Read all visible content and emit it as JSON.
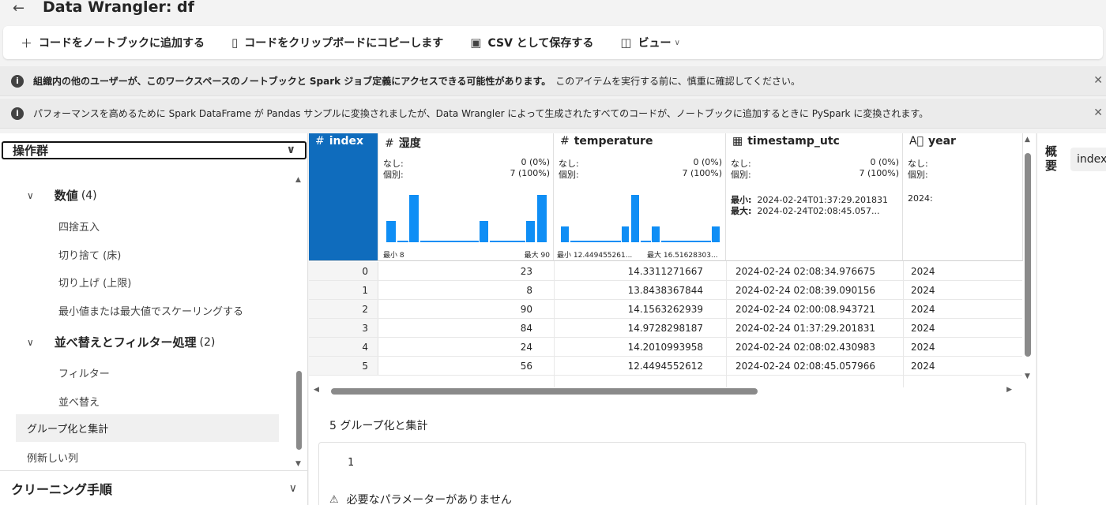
{
  "window": {
    "title": "Data Wrangler: df"
  },
  "toolbar": {
    "add_code": "コードをノートブックに追加する",
    "copy_code": "コードをクリップボードにコピーします",
    "save_csv": "CSV として保存する",
    "view": "ビュー"
  },
  "banners": [
    {
      "bold": "組織内の他のユーザーが、このワークスペースのノートブックと Spark ジョブ定義にアクセスできる可能性があります。",
      "text": "このアイテムを実行する前に、慎重に確認してください。"
    },
    {
      "bold": "",
      "text": "パフォーマンスを高めるために Spark DataFrame が Pandas サンプルに変換されましたが、Data Wrangler によって生成されたすべてのコードが、ノートブックに追加するときに PySpark に変換されます。"
    }
  ],
  "operations": {
    "header": "操作群",
    "categories": [
      {
        "name": "数値",
        "count": "(4)",
        "items": [
          "四捨五入",
          "切り捨て (床)",
          "切り上げ (上限)",
          "最小値または最大値でスケーリングする"
        ]
      },
      {
        "name": "並べ替えとフィルター処理",
        "count": "(2)",
        "items": [
          "フィルター",
          "並べ替え"
        ]
      }
    ],
    "selected": "グループ化と集計",
    "last": "例新しい列",
    "cleaning": "クリーニング手順"
  },
  "columns": [
    {
      "name": "index",
      "type_icon": "#"
    },
    {
      "name": "湿度",
      "type_icon": "#",
      "missing_label": "なし:",
      "missing": "0 (0%)",
      "distinct_label": "個別:",
      "distinct": "7 (100%)",
      "min_label": "最小 8",
      "max_label": "最大 90",
      "histogram": [
        0.45,
        0.05,
        1.0,
        0.05,
        0.05,
        0.05,
        0.05,
        0.05,
        0.45,
        0.05,
        0.05,
        0.05,
        0.45,
        1.0
      ]
    },
    {
      "name": "temperature",
      "type_icon": "#",
      "missing_label": "なし:",
      "missing": "0 (0%)",
      "distinct_label": "個別:",
      "distinct": "7 (100%)",
      "min_label": "最小 12.449455261...",
      "max_label": "最大 16.51628303...",
      "histogram": [
        0.33,
        0.05,
        0.05,
        0.05,
        0.05,
        0.05,
        0.33,
        1.0,
        0.05,
        0.33,
        0.05,
        0.05,
        0.05,
        0.05,
        0.05,
        0.33
      ]
    },
    {
      "name": "timestamp_utc",
      "type_icon": "datetime-icon",
      "missing_label": "なし:",
      "missing": "0 (0%)",
      "distinct_label": "個別:",
      "distinct": "7 (100%)",
      "min_label": "最小:",
      "min": "2024-02-24T01:37:29.201831",
      "max_label": "最大:",
      "max": "2024-02-24T02:08:45.057..."
    },
    {
      "name": "year",
      "type_icon": "text-icon",
      "missing_label": "なし:",
      "distinct_label": "個別:",
      "min": "2024:"
    }
  ],
  "rows": [
    {
      "index": "0",
      "humidity": "23",
      "temperature": "14.3311271667",
      "timestamp": "2024-02-24 02:08:34.976675",
      "year": "2024"
    },
    {
      "index": "1",
      "humidity": "8",
      "temperature": "13.8438367844",
      "timestamp": "2024-02-24 02:08:39.090156",
      "year": "2024"
    },
    {
      "index": "2",
      "humidity": "90",
      "temperature": "14.1563262939",
      "timestamp": "2024-02-24 02:00:08.943721",
      "year": "2024"
    },
    {
      "index": "3",
      "humidity": "84",
      "temperature": "14.9728298187",
      "timestamp": "2024-02-24 01:37:29.201831",
      "year": "2024"
    },
    {
      "index": "4",
      "humidity": "24",
      "temperature": "14.2010993958",
      "timestamp": "2024-02-24 02:08:02.430983",
      "year": "2024"
    },
    {
      "index": "5",
      "humidity": "56",
      "temperature": "12.4494552612",
      "timestamp": "2024-02-24 02:08:45.057966",
      "year": "2024"
    }
  ],
  "op_panel": {
    "title": "5 グループ化と集計",
    "code_line": "1",
    "warning": "必要なパラメーターがありません"
  },
  "summary": {
    "label": "概要",
    "chip": "index"
  },
  "colors": {
    "accent": "#0f6cbd",
    "histogram": "#0f8ef5"
  }
}
